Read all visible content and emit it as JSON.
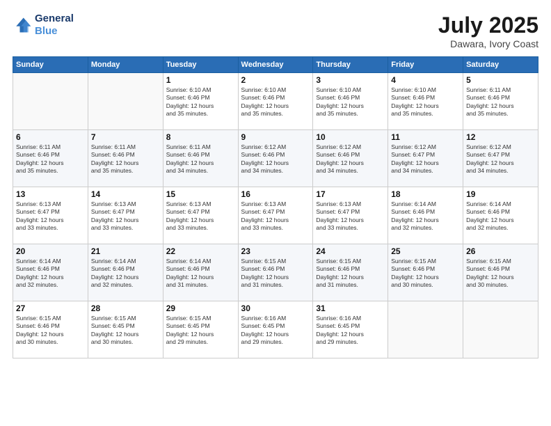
{
  "logo": {
    "line1": "General",
    "line2": "Blue"
  },
  "header": {
    "month": "July 2025",
    "location": "Dawara, Ivory Coast"
  },
  "days_of_week": [
    "Sunday",
    "Monday",
    "Tuesday",
    "Wednesday",
    "Thursday",
    "Friday",
    "Saturday"
  ],
  "weeks": [
    [
      {
        "day": "",
        "content": ""
      },
      {
        "day": "",
        "content": ""
      },
      {
        "day": "1",
        "content": "Sunrise: 6:10 AM\nSunset: 6:46 PM\nDaylight: 12 hours\nand 35 minutes."
      },
      {
        "day": "2",
        "content": "Sunrise: 6:10 AM\nSunset: 6:46 PM\nDaylight: 12 hours\nand 35 minutes."
      },
      {
        "day": "3",
        "content": "Sunrise: 6:10 AM\nSunset: 6:46 PM\nDaylight: 12 hours\nand 35 minutes."
      },
      {
        "day": "4",
        "content": "Sunrise: 6:10 AM\nSunset: 6:46 PM\nDaylight: 12 hours\nand 35 minutes."
      },
      {
        "day": "5",
        "content": "Sunrise: 6:11 AM\nSunset: 6:46 PM\nDaylight: 12 hours\nand 35 minutes."
      }
    ],
    [
      {
        "day": "6",
        "content": "Sunrise: 6:11 AM\nSunset: 6:46 PM\nDaylight: 12 hours\nand 35 minutes."
      },
      {
        "day": "7",
        "content": "Sunrise: 6:11 AM\nSunset: 6:46 PM\nDaylight: 12 hours\nand 35 minutes."
      },
      {
        "day": "8",
        "content": "Sunrise: 6:11 AM\nSunset: 6:46 PM\nDaylight: 12 hours\nand 34 minutes."
      },
      {
        "day": "9",
        "content": "Sunrise: 6:12 AM\nSunset: 6:46 PM\nDaylight: 12 hours\nand 34 minutes."
      },
      {
        "day": "10",
        "content": "Sunrise: 6:12 AM\nSunset: 6:46 PM\nDaylight: 12 hours\nand 34 minutes."
      },
      {
        "day": "11",
        "content": "Sunrise: 6:12 AM\nSunset: 6:47 PM\nDaylight: 12 hours\nand 34 minutes."
      },
      {
        "day": "12",
        "content": "Sunrise: 6:12 AM\nSunset: 6:47 PM\nDaylight: 12 hours\nand 34 minutes."
      }
    ],
    [
      {
        "day": "13",
        "content": "Sunrise: 6:13 AM\nSunset: 6:47 PM\nDaylight: 12 hours\nand 33 minutes."
      },
      {
        "day": "14",
        "content": "Sunrise: 6:13 AM\nSunset: 6:47 PM\nDaylight: 12 hours\nand 33 minutes."
      },
      {
        "day": "15",
        "content": "Sunrise: 6:13 AM\nSunset: 6:47 PM\nDaylight: 12 hours\nand 33 minutes."
      },
      {
        "day": "16",
        "content": "Sunrise: 6:13 AM\nSunset: 6:47 PM\nDaylight: 12 hours\nand 33 minutes."
      },
      {
        "day": "17",
        "content": "Sunrise: 6:13 AM\nSunset: 6:47 PM\nDaylight: 12 hours\nand 33 minutes."
      },
      {
        "day": "18",
        "content": "Sunrise: 6:14 AM\nSunset: 6:46 PM\nDaylight: 12 hours\nand 32 minutes."
      },
      {
        "day": "19",
        "content": "Sunrise: 6:14 AM\nSunset: 6:46 PM\nDaylight: 12 hours\nand 32 minutes."
      }
    ],
    [
      {
        "day": "20",
        "content": "Sunrise: 6:14 AM\nSunset: 6:46 PM\nDaylight: 12 hours\nand 32 minutes."
      },
      {
        "day": "21",
        "content": "Sunrise: 6:14 AM\nSunset: 6:46 PM\nDaylight: 12 hours\nand 32 minutes."
      },
      {
        "day": "22",
        "content": "Sunrise: 6:14 AM\nSunset: 6:46 PM\nDaylight: 12 hours\nand 31 minutes."
      },
      {
        "day": "23",
        "content": "Sunrise: 6:15 AM\nSunset: 6:46 PM\nDaylight: 12 hours\nand 31 minutes."
      },
      {
        "day": "24",
        "content": "Sunrise: 6:15 AM\nSunset: 6:46 PM\nDaylight: 12 hours\nand 31 minutes."
      },
      {
        "day": "25",
        "content": "Sunrise: 6:15 AM\nSunset: 6:46 PM\nDaylight: 12 hours\nand 30 minutes."
      },
      {
        "day": "26",
        "content": "Sunrise: 6:15 AM\nSunset: 6:46 PM\nDaylight: 12 hours\nand 30 minutes."
      }
    ],
    [
      {
        "day": "27",
        "content": "Sunrise: 6:15 AM\nSunset: 6:46 PM\nDaylight: 12 hours\nand 30 minutes."
      },
      {
        "day": "28",
        "content": "Sunrise: 6:15 AM\nSunset: 6:45 PM\nDaylight: 12 hours\nand 30 minutes."
      },
      {
        "day": "29",
        "content": "Sunrise: 6:15 AM\nSunset: 6:45 PM\nDaylight: 12 hours\nand 29 minutes."
      },
      {
        "day": "30",
        "content": "Sunrise: 6:16 AM\nSunset: 6:45 PM\nDaylight: 12 hours\nand 29 minutes."
      },
      {
        "day": "31",
        "content": "Sunrise: 6:16 AM\nSunset: 6:45 PM\nDaylight: 12 hours\nand 29 minutes."
      },
      {
        "day": "",
        "content": ""
      },
      {
        "day": "",
        "content": ""
      }
    ]
  ]
}
